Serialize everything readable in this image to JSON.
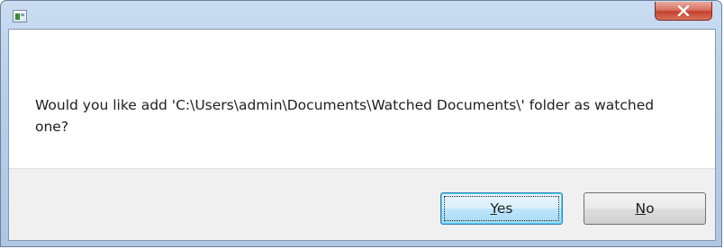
{
  "window": {
    "title": "",
    "icon": "application-icon",
    "close_glyph": "X"
  },
  "dialog": {
    "message": "Would you like add 'C:\\Users\\admin\\Documents\\Watched Documents\\' folder as watched one?",
    "buttons": [
      {
        "label_mnemonic": "Y",
        "label_rest": "es",
        "default": true
      },
      {
        "label_mnemonic": "N",
        "label_rest": "o",
        "default": false
      }
    ]
  },
  "colors": {
    "close_button": "#c4412d",
    "default_button_border": "#3c7fb1",
    "footer_background": "#f0f0f0"
  }
}
